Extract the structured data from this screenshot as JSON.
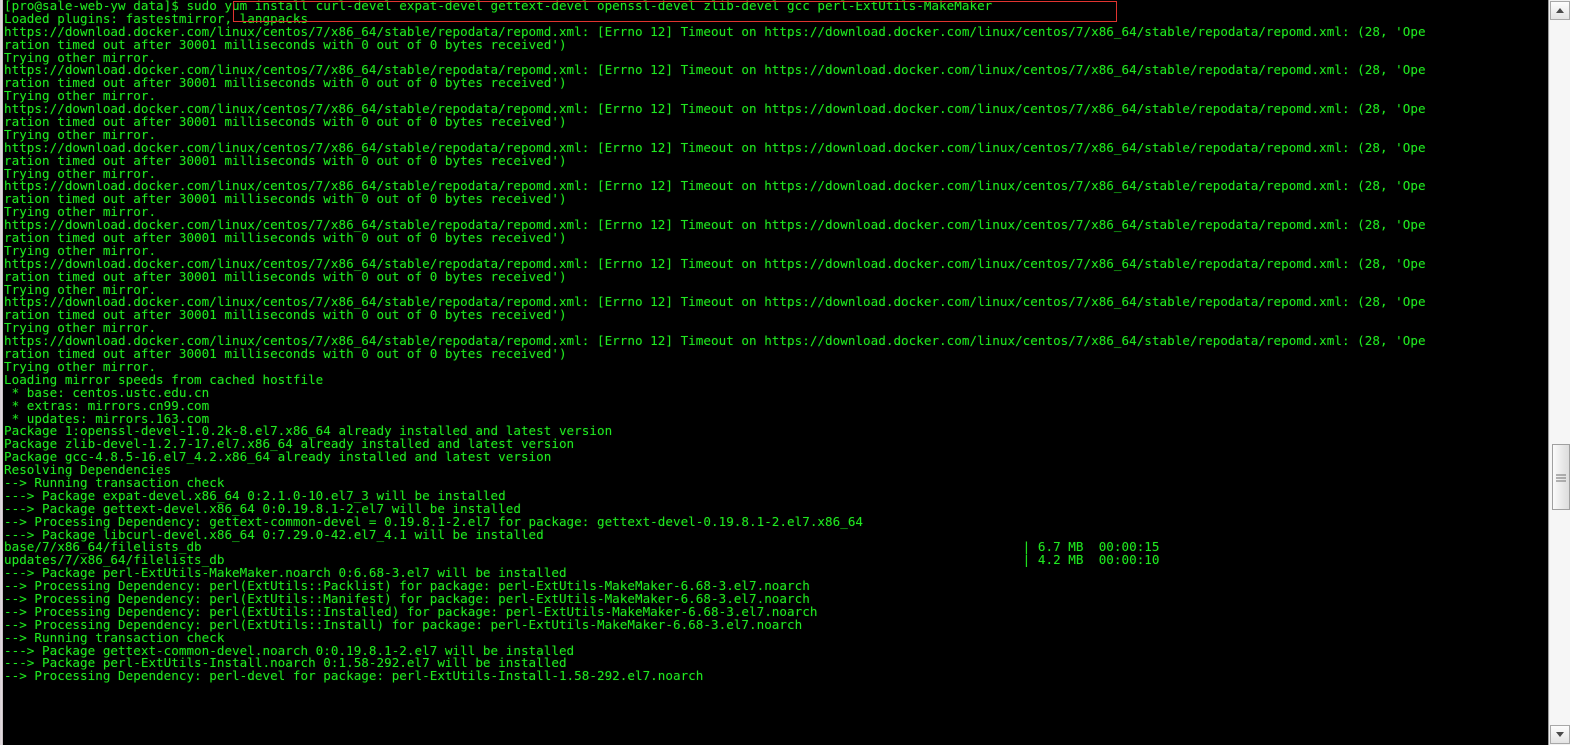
{
  "terminal": {
    "prompt": "[pro@sale-web-yw data]$ sudo ",
    "command": "yum install curl-devel expat-devel gettext-devel openssl-devel zlib-devel gcc perl-ExtUtils-MakeMaker",
    "text_color": "#21e821",
    "background_color": "#000000",
    "highlight_color": "#e0332f",
    "lines": [
      "[pro@sale-web-yw data]$ sudo yum install curl-devel expat-devel gettext-devel openssl-devel zlib-devel gcc perl-ExtUtils-MakeMaker",
      "Loaded plugins: fastestmirror, langpacks",
      "https://download.docker.com/linux/centos/7/x86_64/stable/repodata/repomd.xml: [Errno 12] Timeout on https://download.docker.com/linux/centos/7/x86_64/stable/repodata/repomd.xml: (28, 'Ope",
      "ration timed out after 30001 milliseconds with 0 out of 0 bytes received')",
      "Trying other mirror.",
      "https://download.docker.com/linux/centos/7/x86_64/stable/repodata/repomd.xml: [Errno 12] Timeout on https://download.docker.com/linux/centos/7/x86_64/stable/repodata/repomd.xml: (28, 'Ope",
      "ration timed out after 30001 milliseconds with 0 out of 0 bytes received')",
      "Trying other mirror.",
      "https://download.docker.com/linux/centos/7/x86_64/stable/repodata/repomd.xml: [Errno 12] Timeout on https://download.docker.com/linux/centos/7/x86_64/stable/repodata/repomd.xml: (28, 'Ope",
      "ration timed out after 30001 milliseconds with 0 out of 0 bytes received')",
      "Trying other mirror.",
      "https://download.docker.com/linux/centos/7/x86_64/stable/repodata/repomd.xml: [Errno 12] Timeout on https://download.docker.com/linux/centos/7/x86_64/stable/repodata/repomd.xml: (28, 'Ope",
      "ration timed out after 30001 milliseconds with 0 out of 0 bytes received')",
      "Trying other mirror.",
      "https://download.docker.com/linux/centos/7/x86_64/stable/repodata/repomd.xml: [Errno 12] Timeout on https://download.docker.com/linux/centos/7/x86_64/stable/repodata/repomd.xml: (28, 'Ope",
      "ration timed out after 30001 milliseconds with 0 out of 0 bytes received')",
      "Trying other mirror.",
      "https://download.docker.com/linux/centos/7/x86_64/stable/repodata/repomd.xml: [Errno 12] Timeout on https://download.docker.com/linux/centos/7/x86_64/stable/repodata/repomd.xml: (28, 'Ope",
      "ration timed out after 30001 milliseconds with 0 out of 0 bytes received')",
      "Trying other mirror.",
      "https://download.docker.com/linux/centos/7/x86_64/stable/repodata/repomd.xml: [Errno 12] Timeout on https://download.docker.com/linux/centos/7/x86_64/stable/repodata/repomd.xml: (28, 'Ope",
      "ration timed out after 30001 milliseconds with 0 out of 0 bytes received')",
      "Trying other mirror.",
      "https://download.docker.com/linux/centos/7/x86_64/stable/repodata/repomd.xml: [Errno 12] Timeout on https://download.docker.com/linux/centos/7/x86_64/stable/repodata/repomd.xml: (28, 'Ope",
      "ration timed out after 30001 milliseconds with 0 out of 0 bytes received')",
      "Trying other mirror.",
      "https://download.docker.com/linux/centos/7/x86_64/stable/repodata/repomd.xml: [Errno 12] Timeout on https://download.docker.com/linux/centos/7/x86_64/stable/repodata/repomd.xml: (28, 'Ope",
      "ration timed out after 30001 milliseconds with 0 out of 0 bytes received')",
      "Trying other mirror.",
      "Loading mirror speeds from cached hostfile",
      " * base: centos.ustc.edu.cn",
      " * extras: mirrors.cn99.com",
      " * updates: mirrors.163.com",
      "Package 1:openssl-devel-1.0.2k-8.el7.x86_64 already installed and latest version",
      "Package zlib-devel-1.2.7-17.el7.x86_64 already installed and latest version",
      "Package gcc-4.8.5-16.el7_4.2.x86_64 already installed and latest version",
      "Resolving Dependencies",
      "--> Running transaction check",
      "---> Package expat-devel.x86_64 0:2.1.0-10.el7_3 will be installed",
      "---> Package gettext-devel.x86_64 0:0.19.8.1-2.el7 will be installed",
      "--> Processing Dependency: gettext-common-devel = 0.19.8.1-2.el7 for package: gettext-devel-0.19.8.1-2.el7.x86_64",
      "---> Package libcurl-devel.x86_64 0:7.29.0-42.el7_4.1 will be installed",
      "base/7/x86_64/filelists_db                                                                                                            | 6.7 MB  00:00:15",
      "updates/7/x86_64/filelists_db                                                                                                         | 4.2 MB  00:00:10",
      "---> Package perl-ExtUtils-MakeMaker.noarch 0:6.68-3.el7 will be installed",
      "--> Processing Dependency: perl(ExtUtils::Packlist) for package: perl-ExtUtils-MakeMaker-6.68-3.el7.noarch",
      "--> Processing Dependency: perl(ExtUtils::Manifest) for package: perl-ExtUtils-MakeMaker-6.68-3.el7.noarch",
      "--> Processing Dependency: perl(ExtUtils::Installed) for package: perl-ExtUtils-MakeMaker-6.68-3.el7.noarch",
      "--> Processing Dependency: perl(ExtUtils::Install) for package: perl-ExtUtils-MakeMaker-6.68-3.el7.noarch",
      "--> Running transaction check",
      "---> Package gettext-common-devel.noarch 0:0.19.8.1-2.el7 will be installed",
      "---> Package perl-ExtUtils-Install.noarch 0:1.58-292.el7 will be installed",
      "--> Processing Dependency: perl-devel for package: perl-ExtUtils-Install-1.58-292.el7.noarch"
    ]
  },
  "scrollbar": {
    "up_arrow": "scroll-up-arrow",
    "down_arrow": "scroll-down-arrow"
  }
}
